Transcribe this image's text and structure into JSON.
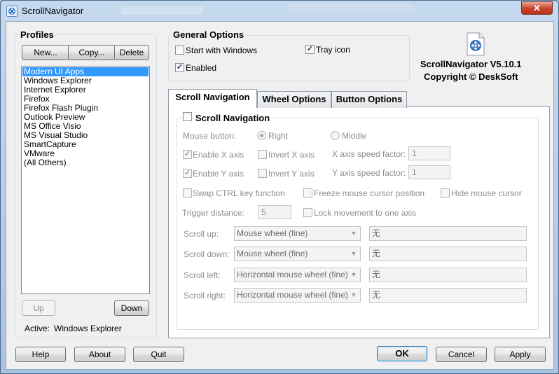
{
  "window": {
    "title": "ScrollNavigator",
    "close_glyph": "✕"
  },
  "profiles": {
    "title": "Profiles",
    "new_label": "New...",
    "copy_label": "Copy...",
    "delete_label": "Delete",
    "items": [
      "Modern UI Apps",
      "Windows Explorer",
      "Internet Explorer",
      "Firefox",
      "Firefox Flash Plugin",
      "Outlook Preview",
      "MS Office Visio",
      "MS Visual Studio",
      "SmartCapture",
      "VMware",
      "(All Others)"
    ],
    "selected_index": 0,
    "up_label": "Up",
    "down_label": "Down",
    "active_label": "Active:",
    "active_value": "Windows Explorer"
  },
  "general_options": {
    "title": "General Options",
    "start_with_windows": {
      "label": "Start with Windows",
      "checked": false
    },
    "tray_icon": {
      "label": "Tray icon",
      "checked": true
    },
    "enabled": {
      "label": "Enabled",
      "checked": true
    }
  },
  "about": {
    "version": "ScrollNavigator V5.10.1",
    "copyright": "Copyright © DeskSoft",
    "icon": "scrollnavigator-document-icon"
  },
  "tabs": [
    "Scroll Navigation",
    "Wheel Options",
    "Button Options"
  ],
  "active_tab": 0,
  "scroll_nav": {
    "group_label": "Scroll Navigation",
    "group_checked": false,
    "mouse_button_label": "Mouse button:",
    "right_label": "Right",
    "middle_label": "Middle",
    "selected_button": "Right",
    "enable_x": {
      "label": "Enable X axis",
      "checked": true
    },
    "invert_x": {
      "label": "Invert X axis",
      "checked": false
    },
    "x_speed_label": "X axis speed factor:",
    "x_speed_value": "1",
    "enable_y": {
      "label": "Enable Y axis",
      "checked": true
    },
    "invert_y": {
      "label": "Invert Y axis",
      "checked": false
    },
    "y_speed_label": "Y axis speed factor:",
    "y_speed_value": "1",
    "swap_ctrl": {
      "label": "Swap CTRL key function",
      "checked": false
    },
    "freeze_cursor": {
      "label": "Freeze mouse cursor position",
      "checked": false
    },
    "hide_cursor": {
      "label": "Hide mouse cursor",
      "checked": false
    },
    "trigger_label": "Trigger distance:",
    "trigger_value": "5",
    "lock_axis": {
      "label": "Lock movement to one axis",
      "checked": false
    },
    "scroll_up": {
      "label": "Scroll up:",
      "value": "Mouse wheel (fine)",
      "hotkey": "无"
    },
    "scroll_down": {
      "label": "Scroll down:",
      "value": "Mouse wheel (fine)",
      "hotkey": "无"
    },
    "scroll_left": {
      "label": "Scroll left:",
      "value": "Horizontal mouse wheel (fine)",
      "hotkey": "无"
    },
    "scroll_right": {
      "label": "Scroll right:",
      "value": "Horizontal mouse wheel (fine)",
      "hotkey": "无"
    }
  },
  "footer": {
    "help_label": "Help",
    "about_label": "About",
    "quit_label": "Quit",
    "ok_label": "OK",
    "cancel_label": "Cancel",
    "apply_label": "Apply"
  },
  "glyphs": {
    "check": "✓",
    "dropdown": "▼"
  },
  "colors": {
    "selection": "#3399ff",
    "title_gradient": "#c5d9ee",
    "close_button": "#c8412a"
  }
}
